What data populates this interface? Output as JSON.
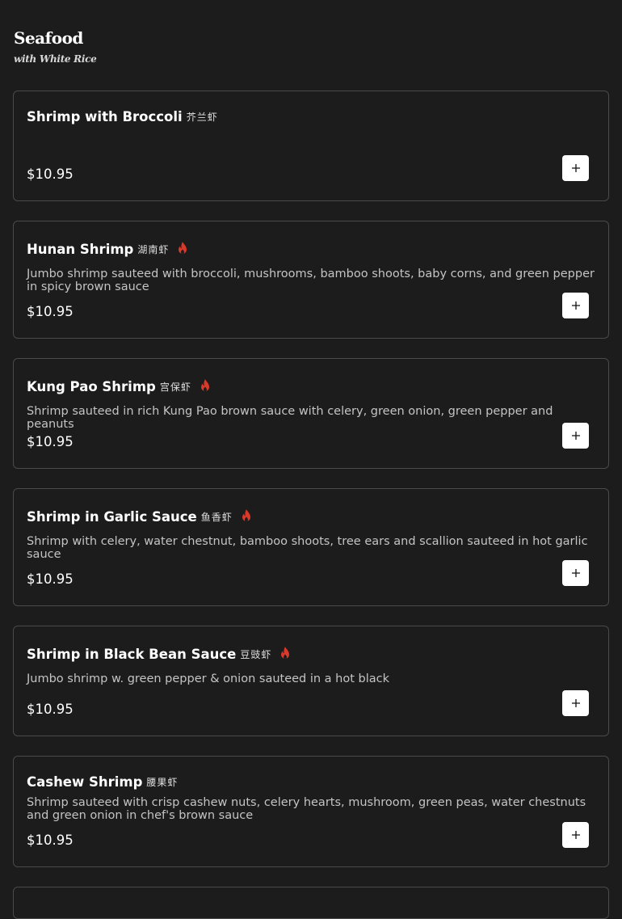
{
  "section": {
    "title": "Seafood",
    "subtitle": "with White Rice"
  },
  "colors": {
    "background": "#1c1c1c",
    "card_border": "#4a4a4a",
    "spicy_icon": "#d9392b",
    "add_button": "#ffffff"
  },
  "icons": {
    "spicy": "flame-icon",
    "add": "plus-icon"
  },
  "items": [
    {
      "name": "Shrimp with Broccoli",
      "chinese": "芥兰虾",
      "spicy": false,
      "description": "",
      "price": "$10.95"
    },
    {
      "name": "Hunan Shrimp",
      "chinese": "湖南虾",
      "spicy": true,
      "description": "Jumbo shrimp sauteed with broccoli, mushrooms, bamboo shoots, baby corns, and green pepper in spicy brown sauce",
      "price": "$10.95"
    },
    {
      "name": "Kung Pao Shrimp",
      "chinese": "宫保虾",
      "spicy": true,
      "description": "Shrimp sauteed in rich Kung Pao brown sauce with celery, green onion, green pepper and peanuts",
      "price": "$10.95"
    },
    {
      "name": "Shrimp in Garlic Sauce",
      "chinese": "鱼香虾",
      "spicy": true,
      "description": "Shrimp with celery, water chestnut, bamboo shoots, tree ears and scallion sauteed in hot garlic sauce",
      "price": "$10.95"
    },
    {
      "name": "Shrimp in Black Bean Sauce",
      "chinese": "豆豉虾",
      "spicy": true,
      "description": "Jumbo shrimp w. green pepper & onion sauteed in a hot black",
      "price": "$10.95"
    },
    {
      "name": "Cashew Shrimp",
      "chinese": "腰果虾",
      "spicy": false,
      "description": "Shrimp sauteed with crisp cashew nuts, celery hearts, mushroom, green peas, water chestnuts and green onion in chef's brown sauce",
      "price": "$10.95"
    }
  ]
}
